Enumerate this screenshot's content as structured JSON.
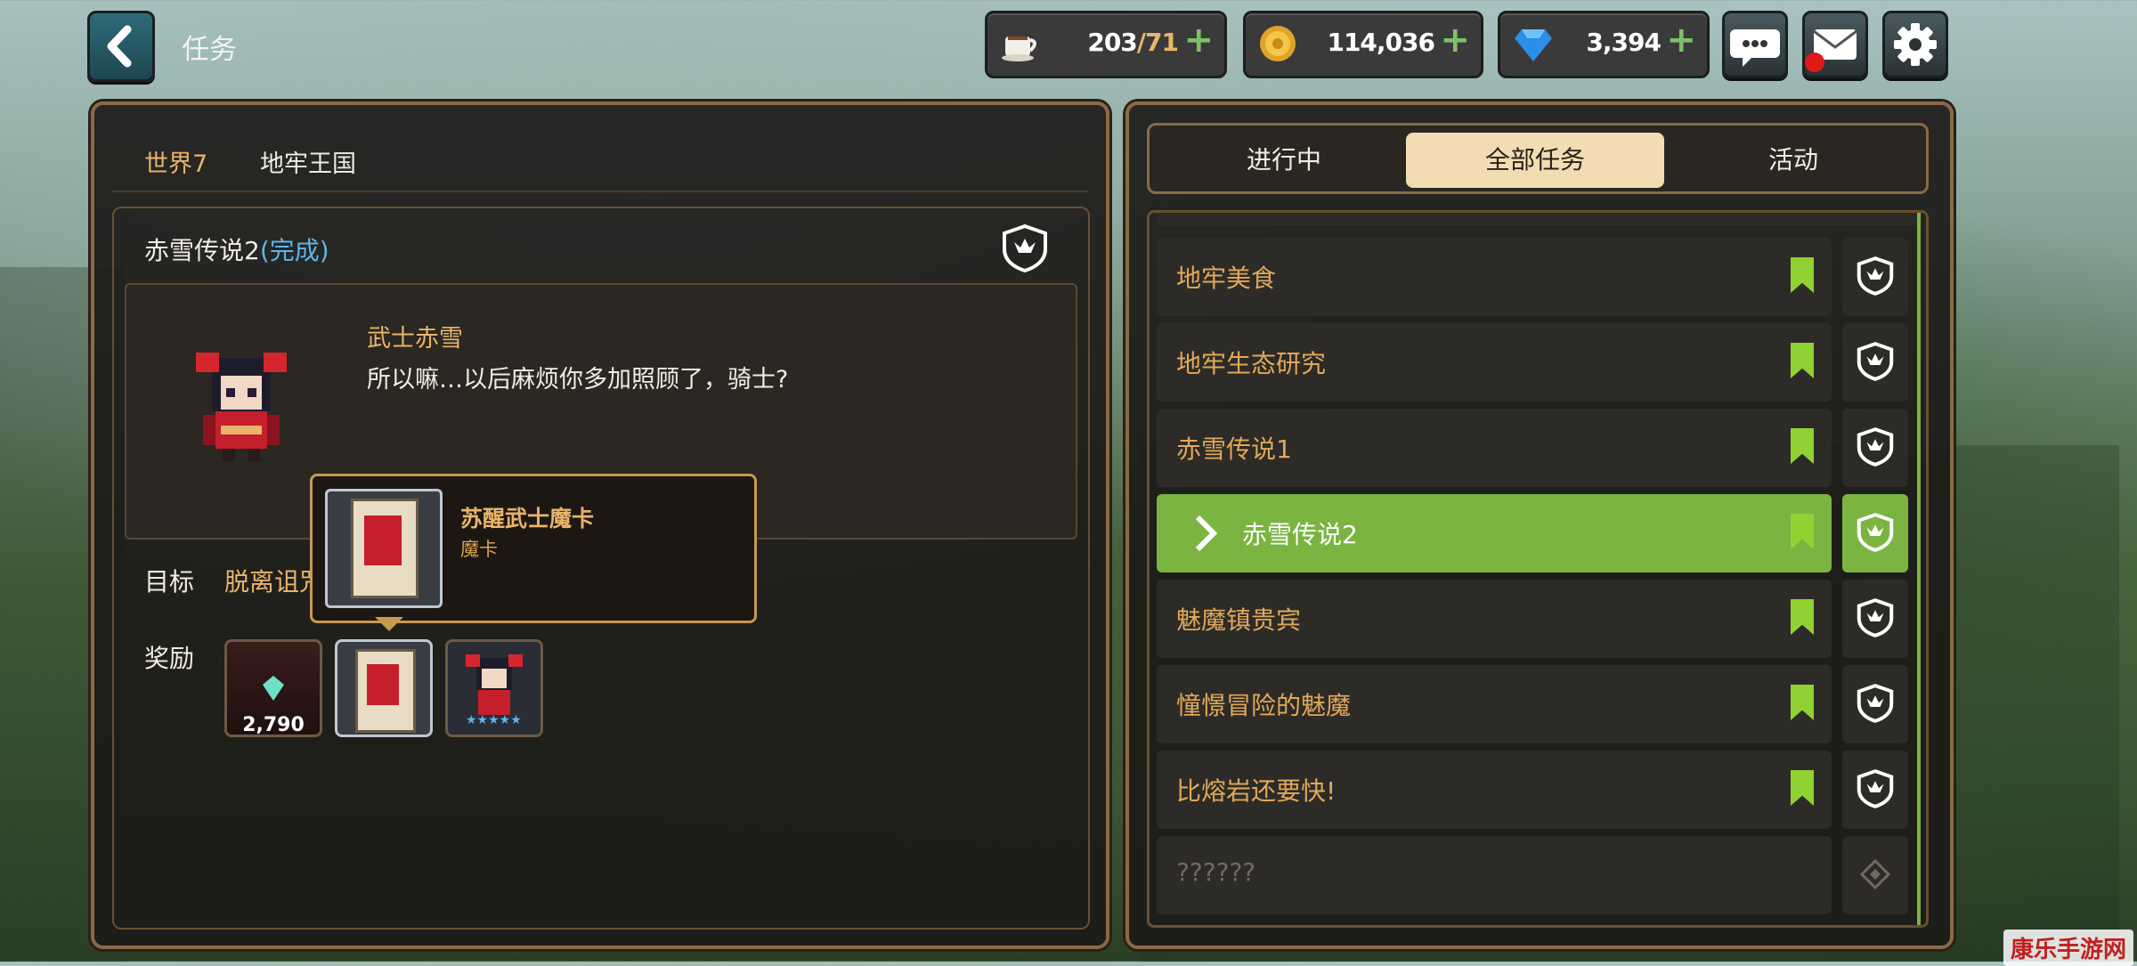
{
  "header": {
    "title": "任务",
    "resources": [
      {
        "icon": "coffee-icon",
        "value": "203",
        "max": "/71"
      },
      {
        "icon": "gold-coin-icon",
        "value": "114,036"
      },
      {
        "icon": "gem-icon",
        "value": "3,394"
      }
    ]
  },
  "left": {
    "world": "世界7",
    "region": "地牢王国",
    "quest_title": "赤雪传说2",
    "quest_status": "(完成)",
    "npc_name": "武士赤雪",
    "dialogue": "所以嘛…以后麻烦你多加照顾了，骑士?",
    "goal_label": "目标",
    "goal_text": "脱离诅咒",
    "reward_label": "奖励",
    "reward_gem_count": "2,790",
    "tooltip": {
      "name": "苏醒武士魔卡",
      "type": "魔卡"
    }
  },
  "right": {
    "tabs": [
      "进行中",
      "全部任务",
      "活动"
    ],
    "active_tab": 1,
    "quests": [
      {
        "name": "地牢美食",
        "state": "done"
      },
      {
        "name": "地牢生态研究",
        "state": "done"
      },
      {
        "name": "赤雪传说1",
        "state": "done"
      },
      {
        "name": "赤雪传说2",
        "state": "selected"
      },
      {
        "name": "魅魔镇贵宾",
        "state": "done"
      },
      {
        "name": "憧憬冒险的魅魔",
        "state": "done"
      },
      {
        "name": "比熔岩还要快!",
        "state": "done"
      },
      {
        "name": "??????",
        "state": "locked"
      }
    ]
  },
  "colors": {
    "accent_green": "#7bb441",
    "gold": "#e9b46b",
    "bookmark": "#8fd232"
  },
  "watermark": "康乐手游网"
}
